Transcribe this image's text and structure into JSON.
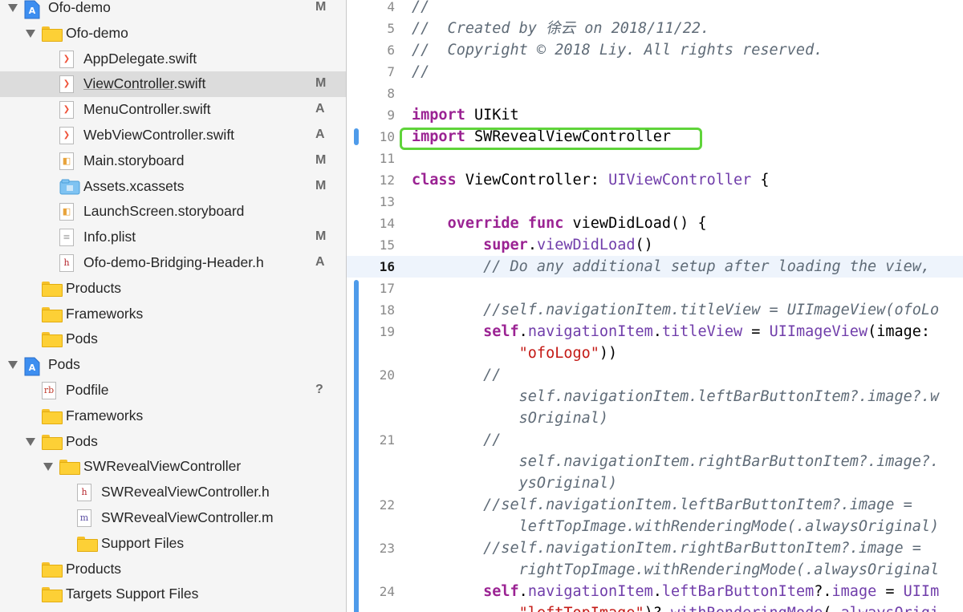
{
  "navigator": {
    "items": [
      {
        "name": "Ofo-demo",
        "icon": "project-icon",
        "depth": 0,
        "disclosure": "open",
        "status": "M"
      },
      {
        "name": "Ofo-demo",
        "icon": "folder-icon",
        "depth": 1,
        "disclosure": "open",
        "status": ""
      },
      {
        "name": "AppDelegate.swift",
        "icon": "swift-file-icon",
        "depth": 2,
        "disclosure": "",
        "status": ""
      },
      {
        "name": "ViewController",
        "suffix": ".swift",
        "icon": "swift-file-icon",
        "depth": 2,
        "disclosure": "",
        "status": "M",
        "selected": true
      },
      {
        "name": "MenuController.swift",
        "icon": "swift-file-icon",
        "depth": 2,
        "disclosure": "",
        "status": "A"
      },
      {
        "name": "WebViewController.swift",
        "icon": "swift-file-icon",
        "depth": 2,
        "disclosure": "",
        "status": "A"
      },
      {
        "name": "Main.storyboard",
        "icon": "storyboard-file-icon",
        "depth": 2,
        "disclosure": "",
        "status": "M"
      },
      {
        "name": "Assets.xcassets",
        "icon": "asset-catalog-icon",
        "depth": 2,
        "disclosure": "",
        "status": "M"
      },
      {
        "name": "LaunchScreen.storyboard",
        "icon": "storyboard-file-icon",
        "depth": 2,
        "disclosure": "",
        "status": ""
      },
      {
        "name": "Info.plist",
        "icon": "plist-file-icon",
        "depth": 2,
        "disclosure": "",
        "status": "M"
      },
      {
        "name": "Ofo-demo-Bridging-Header.h",
        "icon": "header-file-icon",
        "depth": 2,
        "disclosure": "",
        "status": "A"
      },
      {
        "name": "Products",
        "icon": "folder-icon",
        "depth": 1,
        "disclosure": "closed",
        "status": ""
      },
      {
        "name": "Frameworks",
        "icon": "folder-icon",
        "depth": 1,
        "disclosure": "closed",
        "status": ""
      },
      {
        "name": "Pods",
        "icon": "folder-icon",
        "depth": 1,
        "disclosure": "closed",
        "status": ""
      },
      {
        "name": "Pods",
        "icon": "project-icon",
        "depth": 0,
        "disclosure": "open",
        "status": ""
      },
      {
        "name": "Podfile",
        "icon": "ruby-file-icon",
        "depth": 1,
        "disclosure": "",
        "status": "?"
      },
      {
        "name": "Frameworks",
        "icon": "folder-icon",
        "depth": 1,
        "disclosure": "closed",
        "status": ""
      },
      {
        "name": "Pods",
        "icon": "folder-icon",
        "depth": 1,
        "disclosure": "open",
        "status": ""
      },
      {
        "name": "SWRevealViewController",
        "icon": "folder-icon",
        "depth": 2,
        "disclosure": "open",
        "status": ""
      },
      {
        "name": "SWRevealViewController.h",
        "icon": "header-file-icon",
        "depth": 3,
        "disclosure": "",
        "status": ""
      },
      {
        "name": "SWRevealViewController.m",
        "icon": "objc-file-icon",
        "depth": 3,
        "disclosure": "",
        "status": ""
      },
      {
        "name": "Support Files",
        "icon": "folder-icon",
        "depth": 3,
        "disclosure": "closed",
        "status": ""
      },
      {
        "name": "Products",
        "icon": "folder-icon",
        "depth": 1,
        "disclosure": "closed",
        "status": ""
      },
      {
        "name": "Targets Support Files",
        "icon": "folder-icon",
        "depth": 1,
        "disclosure": "closed",
        "status": ""
      }
    ]
  },
  "editor": {
    "current_line": "16",
    "lines": [
      {
        "num": "4",
        "segments": [
          {
            "t": "//",
            "c": "cm"
          }
        ]
      },
      {
        "num": "5",
        "segments": [
          {
            "t": "//  Created by 徐云 on 2018/11/22.",
            "c": "cm"
          }
        ]
      },
      {
        "num": "6",
        "segments": [
          {
            "t": "//  Copyright © 2018 Liy. All rights reserved.",
            "c": "cm"
          }
        ]
      },
      {
        "num": "7",
        "segments": [
          {
            "t": "//",
            "c": "cm"
          }
        ]
      },
      {
        "num": "8",
        "segments": []
      },
      {
        "num": "9",
        "segments": [
          {
            "t": "import",
            "c": "kw"
          },
          {
            "t": " UIKit",
            "c": ""
          }
        ]
      },
      {
        "num": "10",
        "segments": [
          {
            "t": "import",
            "c": "kw"
          },
          {
            "t": " SWRevealViewController",
            "c": ""
          }
        ],
        "changed": true
      },
      {
        "num": "11",
        "segments": []
      },
      {
        "num": "12",
        "segments": [
          {
            "t": "class",
            "c": "kw"
          },
          {
            "t": " ViewController: ",
            "c": ""
          },
          {
            "t": "UIViewController",
            "c": "ty"
          },
          {
            "t": " {",
            "c": ""
          }
        ]
      },
      {
        "num": "13",
        "segments": []
      },
      {
        "num": "14",
        "segments": [
          {
            "t": "    ",
            "c": ""
          },
          {
            "t": "override",
            "c": "kw"
          },
          {
            "t": " ",
            "c": ""
          },
          {
            "t": "func",
            "c": "kw"
          },
          {
            "t": " viewDidLoad() {",
            "c": ""
          }
        ]
      },
      {
        "num": "15",
        "segments": [
          {
            "t": "        ",
            "c": ""
          },
          {
            "t": "super",
            "c": "kw"
          },
          {
            "t": ".",
            "c": ""
          },
          {
            "t": "viewDidLoad",
            "c": "ty"
          },
          {
            "t": "()",
            "c": ""
          }
        ]
      },
      {
        "num": "16",
        "segments": [
          {
            "t": "        // Do any additional setup after loading the view,",
            "c": "cm"
          }
        ],
        "current": true
      },
      {
        "num": "17",
        "segments": [],
        "changed": true
      },
      {
        "num": "18",
        "segments": [
          {
            "t": "        //self.navigationItem.titleView = UIImageView(ofoLo",
            "c": "cm"
          }
        ],
        "changed": true
      },
      {
        "num": "19",
        "segments": [
          {
            "t": "        ",
            "c": ""
          },
          {
            "t": "self",
            "c": "kw"
          },
          {
            "t": ".",
            "c": ""
          },
          {
            "t": "navigationItem",
            "c": "ty"
          },
          {
            "t": ".",
            "c": ""
          },
          {
            "t": "titleView",
            "c": "ty"
          },
          {
            "t": " = ",
            "c": ""
          },
          {
            "t": "UIImageView",
            "c": "ty"
          },
          {
            "t": "(image:",
            "c": ""
          }
        ],
        "changed": true
      },
      {
        "num": "",
        "segments": [
          {
            "t": "            ",
            "c": ""
          },
          {
            "t": "\"ofoLogo\"",
            "c": "str"
          },
          {
            "t": "))",
            "c": ""
          }
        ],
        "changed": true
      },
      {
        "num": "20",
        "segments": [
          {
            "t": "        //",
            "c": "cm"
          }
        ],
        "changed": true
      },
      {
        "num": "",
        "segments": [
          {
            "t": "            self.navigationItem.leftBarButtonItem?.image?.w",
            "c": "cm"
          }
        ],
        "changed": true
      },
      {
        "num": "",
        "segments": [
          {
            "t": "            sOriginal)",
            "c": "cm"
          }
        ],
        "changed": true
      },
      {
        "num": "21",
        "segments": [
          {
            "t": "        //",
            "c": "cm"
          }
        ],
        "changed": true
      },
      {
        "num": "",
        "segments": [
          {
            "t": "            self.navigationItem.rightBarButtonItem?.image?.",
            "c": "cm"
          }
        ],
        "changed": true
      },
      {
        "num": "",
        "segments": [
          {
            "t": "            ysOriginal)",
            "c": "cm"
          }
        ],
        "changed": true
      },
      {
        "num": "22",
        "segments": [
          {
            "t": "        //self.navigationItem.leftBarButtonItem?.image =",
            "c": "cm"
          }
        ],
        "changed": true
      },
      {
        "num": "",
        "segments": [
          {
            "t": "            leftTopImage.withRenderingMode(.alwaysOriginal)",
            "c": "cm"
          }
        ],
        "changed": true
      },
      {
        "num": "23",
        "segments": [
          {
            "t": "        //self.navigationItem.rightBarButtonItem?.image =",
            "c": "cm"
          }
        ],
        "changed": true
      },
      {
        "num": "",
        "segments": [
          {
            "t": "            rightTopImage.withRenderingMode(.alwaysOriginal",
            "c": "cm"
          }
        ],
        "changed": true
      },
      {
        "num": "24",
        "segments": [
          {
            "t": "        ",
            "c": ""
          },
          {
            "t": "self",
            "c": "kw"
          },
          {
            "t": ".",
            "c": ""
          },
          {
            "t": "navigationItem",
            "c": "ty"
          },
          {
            "t": ".",
            "c": ""
          },
          {
            "t": "leftBarButtonItem",
            "c": "ty"
          },
          {
            "t": "?.",
            "c": ""
          },
          {
            "t": "image",
            "c": "ty"
          },
          {
            "t": " = ",
            "c": ""
          },
          {
            "t": "UIIm",
            "c": "ty"
          }
        ],
        "changed": true
      },
      {
        "num": "",
        "segments": [
          {
            "t": "            ",
            "c": ""
          },
          {
            "t": "\"leftTopImage\"",
            "c": "str"
          },
          {
            "t": ")?.",
            "c": ""
          },
          {
            "t": "withRenderingMode",
            "c": "ty"
          },
          {
            "t": "(.",
            "c": ""
          },
          {
            "t": "alwaysOrigi",
            "c": "ty"
          }
        ],
        "changed": true
      }
    ]
  },
  "colors": {
    "keyword": "#9b2393",
    "type": "#703daa",
    "string": "#c41a16",
    "comment": "#5f6b77",
    "highlight_box": "#5fd43a",
    "change_bar": "#4e9bea",
    "selection": "#dcdcdc"
  }
}
